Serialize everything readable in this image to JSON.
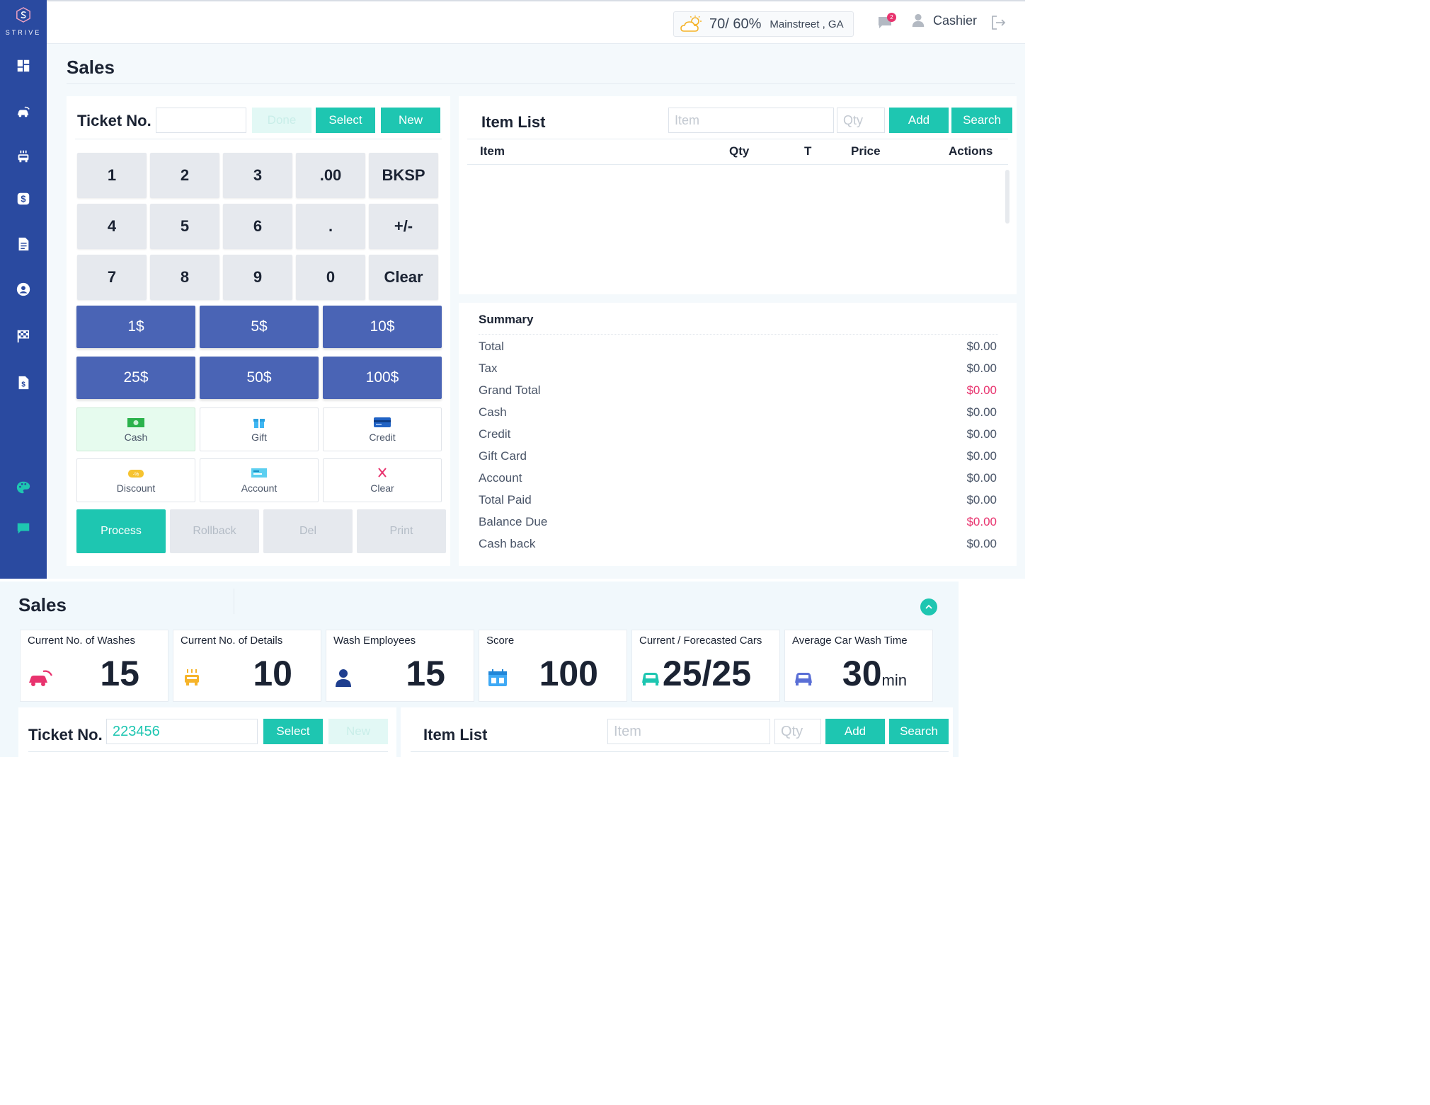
{
  "brand": {
    "name": "STRIVE"
  },
  "sidebar": {
    "items": [
      {
        "icon": "dashboard-icon"
      },
      {
        "icon": "car-wash-icon"
      },
      {
        "icon": "car-detail-icon"
      },
      {
        "icon": "dollar-icon"
      },
      {
        "icon": "document-icon"
      },
      {
        "icon": "user-circle-icon"
      },
      {
        "icon": "race-flag-icon"
      },
      {
        "icon": "invoice-icon"
      },
      {
        "icon": "palette-icon"
      },
      {
        "icon": "chat-icon"
      }
    ]
  },
  "header": {
    "weather": {
      "temp": "70/ 60%",
      "location": "Mainstreet , GA"
    },
    "notifications": {
      "count": "2"
    },
    "user": {
      "role": "Cashier"
    }
  },
  "page": {
    "title": "Sales"
  },
  "ticket": {
    "label": "Ticket No.",
    "value": "",
    "buttons": {
      "done": "Done",
      "select": "Select",
      "new": "New"
    }
  },
  "keypad": {
    "keys": [
      "1",
      "2",
      "3",
      ".00",
      "BKSP",
      "4",
      "5",
      "6",
      ".",
      "+/-",
      "7",
      "8",
      "9",
      "0",
      "Clear"
    ],
    "cash": [
      "1$",
      "5$",
      "10$",
      "25$",
      "50$",
      "100$"
    ],
    "payment": [
      "Cash",
      "Gift",
      "Credit",
      "Discount",
      "Account",
      "Clear"
    ],
    "actions": [
      "Process",
      "Rollback",
      "Del",
      "Print"
    ]
  },
  "item_list": {
    "title": "Item List",
    "item_placeholder": "Item",
    "qty_placeholder": "Qty",
    "add": "Add",
    "search": "Search",
    "columns": [
      "Item",
      "Qty",
      "T",
      "Price",
      "Actions"
    ]
  },
  "summary": {
    "title": "Summary",
    "rows": [
      {
        "label": "Total",
        "value": "$0.00"
      },
      {
        "label": "Tax",
        "value": "$0.00"
      },
      {
        "label": "Grand Total",
        "value": "$0.00"
      },
      {
        "label": "Cash",
        "value": "$0.00"
      },
      {
        "label": "Credit",
        "value": "$0.00"
      },
      {
        "label": "Gift Card",
        "value": "$0.00"
      },
      {
        "label": "Account",
        "value": "$0.00"
      },
      {
        "label": "Total Paid",
        "value": "$0.00"
      },
      {
        "label": "Balance Due",
        "value": "$0.00"
      },
      {
        "label": "Cash back",
        "value": "$0.00"
      }
    ],
    "highlight_color": "#e8336e"
  },
  "bottom": {
    "title": "Sales",
    "stats": [
      {
        "label": "Current No. of Washes",
        "value": "15",
        "unit": ""
      },
      {
        "label": "Current No. of Details",
        "value": "10",
        "unit": ""
      },
      {
        "label": "Wash Employees",
        "value": "15",
        "unit": ""
      },
      {
        "label": "Score",
        "value": "100",
        "unit": ""
      },
      {
        "label": "Current / Forecasted Cars",
        "value": "25/25",
        "unit": ""
      },
      {
        "label": "Average Car Wash Time",
        "value": "30",
        "unit": "min"
      }
    ],
    "ticket": {
      "label": "Ticket No.",
      "value": "223456",
      "select": "Select",
      "new": "New"
    },
    "item_list": {
      "title": "Item List",
      "item_placeholder": "Item",
      "qty_placeholder": "Qty",
      "add": "Add",
      "search": "Search"
    }
  },
  "colors": {
    "accent": "#1ec6b1",
    "sidebar": "#2a4aa0",
    "cash_key": "#4a64b5",
    "alert": "#e8336e"
  }
}
